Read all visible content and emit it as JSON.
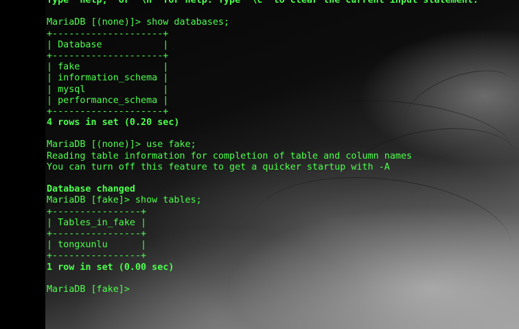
{
  "terminal": {
    "lines": [
      {
        "text": "Type 'help;' or '\\h' for help. Type '\\c' to clear the current input statement.",
        "bold": true
      },
      {
        "text": "",
        "bold": false
      },
      {
        "text": "MariaDB [(none)]> show databases;",
        "bold": false
      },
      {
        "text": "+--------------------+",
        "bold": false
      },
      {
        "text": "| Database           |",
        "bold": false
      },
      {
        "text": "+--------------------+",
        "bold": false
      },
      {
        "text": "| fake               |",
        "bold": false
      },
      {
        "text": "| information_schema |",
        "bold": false
      },
      {
        "text": "| mysql              |",
        "bold": false
      },
      {
        "text": "| performance_schema |",
        "bold": false
      },
      {
        "text": "+--------------------+",
        "bold": false
      },
      {
        "text": "4 rows in set (0.20 sec)",
        "bold": true
      },
      {
        "text": "",
        "bold": false
      },
      {
        "text": "MariaDB [(none)]> use fake;",
        "bold": false
      },
      {
        "text": "Reading table information for completion of table and column names",
        "bold": false
      },
      {
        "text": "You can turn off this feature to get a quicker startup with -A",
        "bold": false
      },
      {
        "text": "",
        "bold": false
      },
      {
        "text": "Database changed",
        "bold": true
      },
      {
        "text": "MariaDB [fake]> show tables;",
        "bold": false
      },
      {
        "text": "+----------------+",
        "bold": false
      },
      {
        "text": "| Tables_in_fake |",
        "bold": false
      },
      {
        "text": "+----------------+",
        "bold": false
      },
      {
        "text": "| tongxunlu      |",
        "bold": false
      },
      {
        "text": "+----------------+",
        "bold": false
      },
      {
        "text": "1 row in set (0.00 sec)",
        "bold": true
      },
      {
        "text": "",
        "bold": false
      },
      {
        "text": "MariaDB [fake]> ",
        "bold": false
      }
    ],
    "text_color": "#4dff4d",
    "background_color": "#000000"
  }
}
